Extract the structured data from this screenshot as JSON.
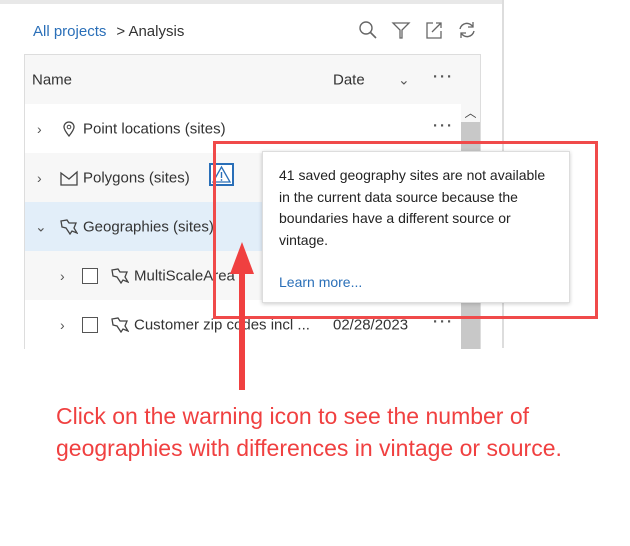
{
  "breadcrumb": {
    "root": "All projects",
    "current": "> Analysis"
  },
  "toolbar": {
    "icons": [
      "search-icon",
      "filter-icon",
      "export-icon",
      "refresh-icon"
    ]
  },
  "table": {
    "headers": {
      "name": "Name",
      "date": "Date",
      "more": "···"
    },
    "rows": [
      {
        "name": "Point locations (sites)",
        "date": "",
        "icon": "pin-icon"
      },
      {
        "name": "Polygons (sites)",
        "date": "",
        "icon": "polygon-icon"
      },
      {
        "name": "Geographies (sites)",
        "date": "",
        "icon": "geography-icon"
      },
      {
        "name": "MultiScaleArea",
        "date": "",
        "icon": "geography-icon"
      },
      {
        "name": "Customer zip codes incl ...",
        "date": "02/28/2023",
        "icon": "geography-icon"
      }
    ]
  },
  "popup": {
    "message": "41 saved geography sites are not available in the current data source because the boundaries have a different source or vintage.",
    "link": "Learn more..."
  },
  "caption": "Click on the warning icon to see the number of geographies with differences in vintage or source.",
  "colors": {
    "accent": "#2a6fb8",
    "annotation": "#f04a4a"
  }
}
